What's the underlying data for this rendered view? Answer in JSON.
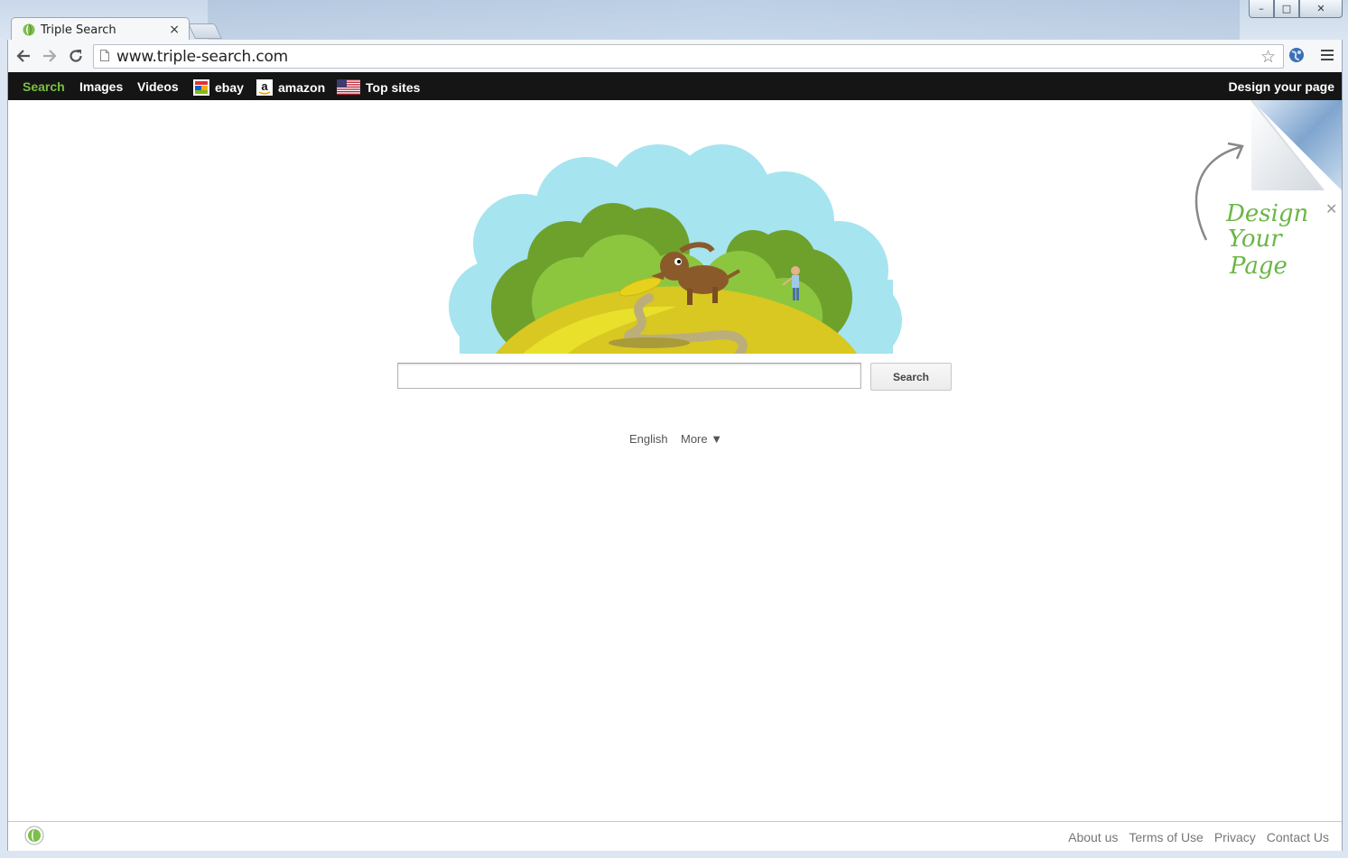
{
  "browser": {
    "tab_title": "Triple Search",
    "tab_close": "×",
    "url": "www.triple-search.com",
    "window_controls": {
      "minimize": "–",
      "maximize": "□",
      "close": "✕"
    }
  },
  "navbar": {
    "items": [
      {
        "label": "Search",
        "active": true
      },
      {
        "label": "Images"
      },
      {
        "label": "Videos"
      },
      {
        "label": "ebay",
        "icon": "ebay-icon"
      },
      {
        "label": "amazon",
        "icon": "amazon-icon"
      },
      {
        "label": "Top sites",
        "icon": "us-flag-icon"
      }
    ],
    "design_label": "Design your page"
  },
  "search": {
    "button_label": "Search",
    "value": "",
    "placeholder": ""
  },
  "language": {
    "current": "English",
    "more": "More ▼"
  },
  "corner_promo": {
    "line1": "Design",
    "line2": "Your",
    "line3": "Page",
    "close": "✕"
  },
  "footer": {
    "links": [
      "About us",
      "Terms of Use",
      "Privacy",
      "Contact Us"
    ]
  },
  "colors": {
    "nav_bg": "#151515",
    "nav_active": "#78c043",
    "promo_text": "#6bb646"
  }
}
